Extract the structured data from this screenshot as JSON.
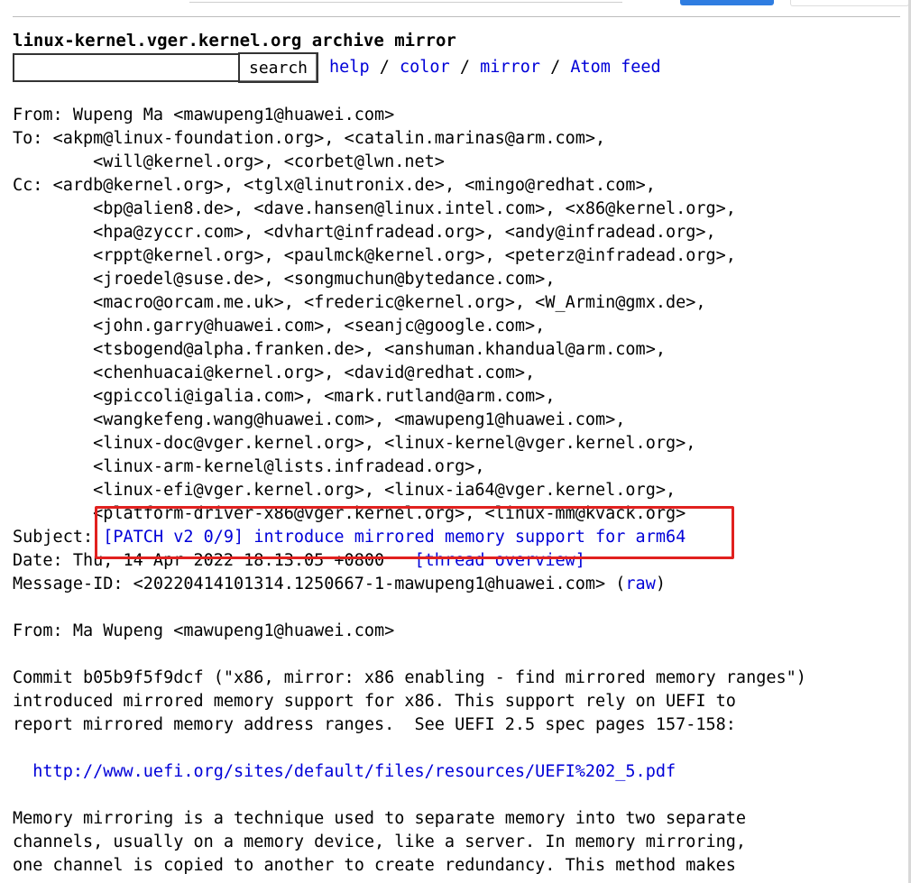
{
  "header": {
    "title": "linux-kernel.vger.kernel.org archive mirror",
    "search_button": "search",
    "links": [
      "help",
      "color",
      "mirror",
      "Atom feed"
    ],
    "sep": " / "
  },
  "message": {
    "from_label": "From: ",
    "from_name": "Wupeng Ma",
    "from_addr": "<mawupeng1@huawei.com>",
    "to_label": "To: ",
    "to_lines": [
      "<akpm@linux-foundation.org>, <catalin.marinas@arm.com>,",
      "<will@kernel.org>, <corbet@lwn.net>"
    ],
    "cc_label": "Cc: ",
    "cc_lines": [
      "<ardb@kernel.org>, <tglx@linutronix.de>, <mingo@redhat.com>,",
      "<bp@alien8.de>, <dave.hansen@linux.intel.com>, <x86@kernel.org>,",
      "<hpa@zyccr.com>, <dvhart@infradead.org>, <andy@infradead.org>,",
      "<rppt@kernel.org>, <paulmck@kernel.org>, <peterz@infradead.org>,",
      "<jroedel@suse.de>, <songmuchun@bytedance.com>,",
      "<macro@orcam.me.uk>, <frederic@kernel.org>, <W_Armin@gmx.de>,",
      "<john.garry@huawei.com>, <seanjc@google.com>,",
      "<tsbogend@alpha.franken.de>, <anshuman.khandual@arm.com>,",
      "<chenhuacai@kernel.org>, <david@redhat.com>,",
      "<gpiccoli@igalia.com>, <mark.rutland@arm.com>,",
      "<wangkefeng.wang@huawei.com>, <mawupeng1@huawei.com>,",
      "<linux-doc@vger.kernel.org>, <linux-kernel@vger.kernel.org>,",
      "<linux-arm-kernel@lists.infradead.org>,",
      "<linux-efi@vger.kernel.org>, <linux-ia64@vger.kernel.org>,",
      "<platform-driver-x86@vger.kernel.org>, <linux-mm@kvack.org>"
    ],
    "subject_label": "Subject: ",
    "subject": "[PATCH v2 0/9] introduce mirrored memory support for arm64",
    "date_label": "Date: ",
    "date": "Thu, 14 Apr 2022 18:13:05 +0800",
    "thread_link": "[thread overview]",
    "msgid_label": "Message-ID: ",
    "msgid": "<20220414101314.1250667-1-mawupeng1@huawei.com>",
    "raw_link": "raw",
    "body_from": "From: Ma Wupeng <mawupeng1@huawei.com>",
    "body_p1": [
      "Commit b05b9f5f9dcf (\"x86, mirror: x86 enabling - find mirrored memory ranges\")",
      "introduced mirrored memory support for x86. This support rely on UEFI to",
      "report mirrored memory address ranges.  See UEFI 2.5 spec pages 157-158:"
    ],
    "url": "http://www.uefi.org/sites/default/files/resources/UEFI%202_5.pdf",
    "body_p2": [
      "Memory mirroring is a technique used to separate memory into two separate",
      "channels, usually on a memory device, like a server. In memory mirroring,",
      "one channel is copied to another to create redundancy. This method makes"
    ]
  },
  "colors": {
    "link": "#0000d8",
    "highlight": "#e1211f"
  }
}
